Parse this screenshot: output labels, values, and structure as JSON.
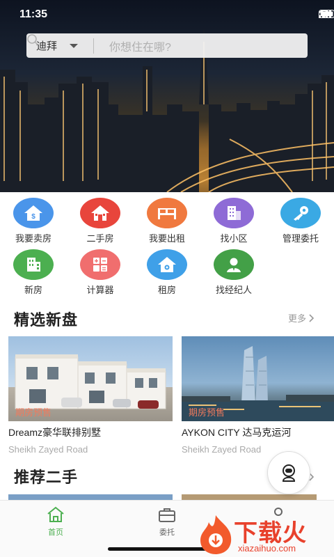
{
  "status_bar": {
    "time": "11:35"
  },
  "search": {
    "city": "迪拜",
    "placeholder": "你想住在哪?"
  },
  "quick_actions": [
    {
      "label": "我要卖房",
      "icon": "house-dollar-icon",
      "color": "#3f8ee6"
    },
    {
      "label": "二手房",
      "icon": "house-key-icon",
      "color": "#e8453c"
    },
    {
      "label": "我要出租",
      "icon": "bed-icon",
      "color": "#f0793f"
    },
    {
      "label": "找小区",
      "icon": "building-icon",
      "color": "#8a63d2"
    },
    {
      "label": "管理委托",
      "icon": "key-icon",
      "color": "#3aa9e4"
    },
    {
      "label": "新房",
      "icon": "apartment-icon",
      "color": "#4caf50"
    },
    {
      "label": "计算器",
      "icon": "calculator-icon",
      "color": "#f06e6e"
    },
    {
      "label": "租房",
      "icon": "house-camera-icon",
      "color": "#3fa0e8"
    },
    {
      "label": "找经纪人",
      "icon": "agent-icon",
      "color": "#43a047"
    }
  ],
  "featured": {
    "title": "精选新盘",
    "more": "更多",
    "cards": [
      {
        "tag": "期房预售",
        "name": "Dreamz豪华联排别墅",
        "address": "Sheikh Zayed Road"
      },
      {
        "tag": "期房预售",
        "name": "AYKON CITY 达马克运河",
        "address": "Sheikh Zayed Road"
      }
    ]
  },
  "recommended": {
    "title": "推荐二手",
    "more": "更多"
  },
  "tabbar": {
    "tabs": [
      {
        "label": "首页",
        "icon": "home-icon",
        "active": true
      },
      {
        "label": "委托",
        "icon": "briefcase-icon",
        "active": false
      }
    ],
    "active_color": "#4caf50",
    "inactive_color": "#666666"
  },
  "watermark": {
    "title": "下载火",
    "url": "xiazaihuo.com"
  }
}
